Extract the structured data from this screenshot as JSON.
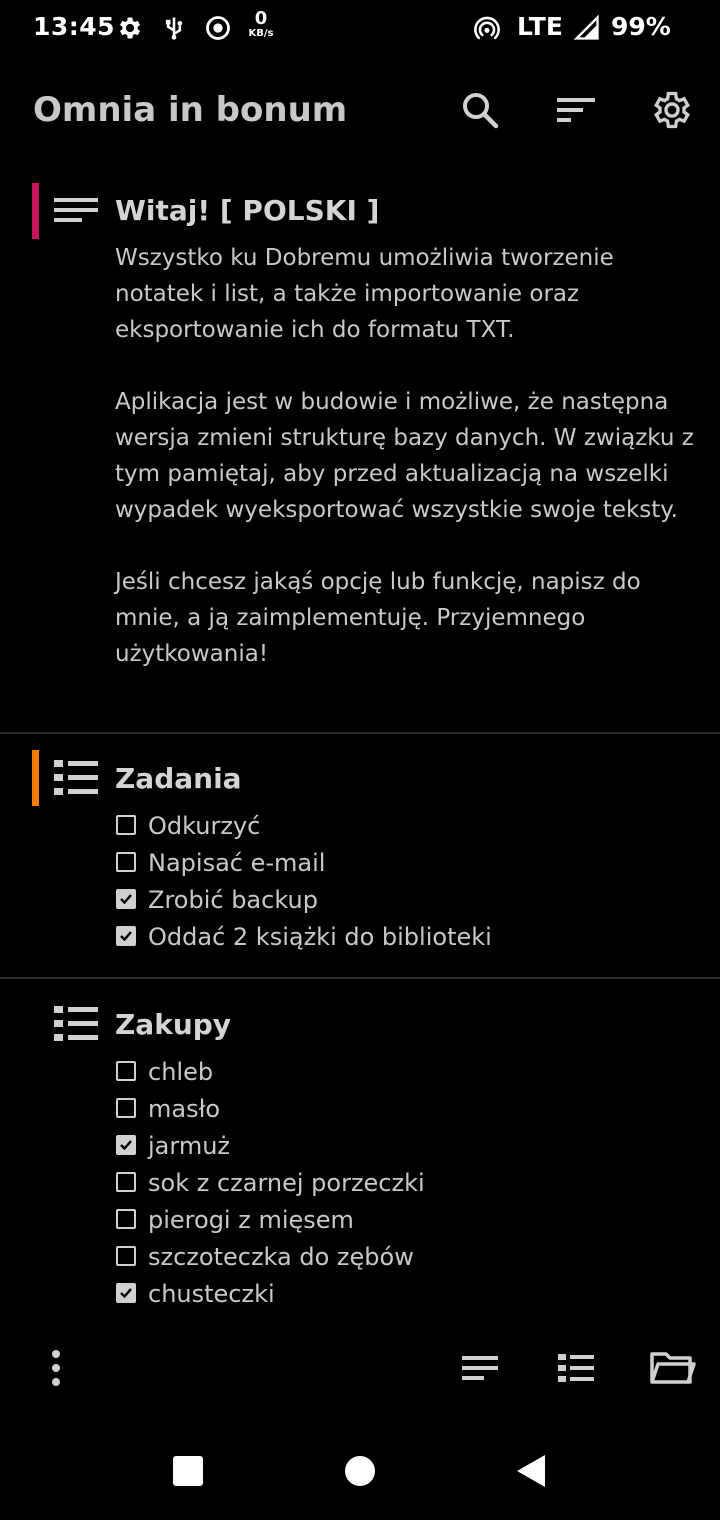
{
  "status_bar": {
    "time": "13:45",
    "net_speed_value": "0",
    "net_speed_unit": "KB/s",
    "network": "LTE",
    "battery": "99%",
    "icons": [
      "gear-icon",
      "usb-icon",
      "record-icon",
      "hotspot-icon",
      "signal-icon"
    ]
  },
  "app_bar": {
    "title": "Omnia in bonum",
    "actions": [
      "search-icon",
      "sort-icon",
      "settings-icon"
    ]
  },
  "notes": [
    {
      "type": "text",
      "accent_color": "#c2185b",
      "title": "Witaj! [ POLSKI ]",
      "paragraphs": [
        "Wszystko ku Dobremu umożliwia tworzenie notatek i list, a także importowanie oraz eksportowanie ich do formatu TXT.",
        "Aplikacja jest w budowie i możliwe, że następna wersja zmieni strukturę bazy danych. W związku z tym pamiętaj, aby przed aktualizacją na wszelki wypadek wyeksportować wszystkie swoje teksty.",
        "Jeśli chcesz jakąś opcję lub funkcję, napisz do mnie, a ją zaimplementuję. Przyjemnego użytkowania!"
      ]
    },
    {
      "type": "checklist",
      "accent_color": "#f57c00",
      "title": "Zadania",
      "items": [
        {
          "text": "Odkurzyć",
          "checked": false
        },
        {
          "text": "Napisać e-mail",
          "checked": false
        },
        {
          "text": "Zrobić backup",
          "checked": true
        },
        {
          "text": "Oddać 2 książki do biblioteki",
          "checked": true
        }
      ]
    },
    {
      "type": "checklist",
      "accent_color": "",
      "title": "Zakupy",
      "items": [
        {
          "text": "chleb",
          "checked": false
        },
        {
          "text": "masło",
          "checked": false
        },
        {
          "text": "jarmuż",
          "checked": true
        },
        {
          "text": "sok z czarnej porzeczki",
          "checked": false
        },
        {
          "text": "pierogi z mięsem",
          "checked": false
        },
        {
          "text": "szczoteczka do zębów",
          "checked": false
        },
        {
          "text": "chusteczki",
          "checked": true
        }
      ]
    }
  ],
  "bottom_toolbar": [
    "more-vert-icon",
    "new-note-icon",
    "new-list-icon",
    "open-folder-icon"
  ],
  "nav_bar": [
    "recents-icon",
    "home-icon",
    "back-icon"
  ],
  "colors": {
    "background": "#000000",
    "text": "#c9c9c9",
    "divider": "#2d2d2d"
  }
}
